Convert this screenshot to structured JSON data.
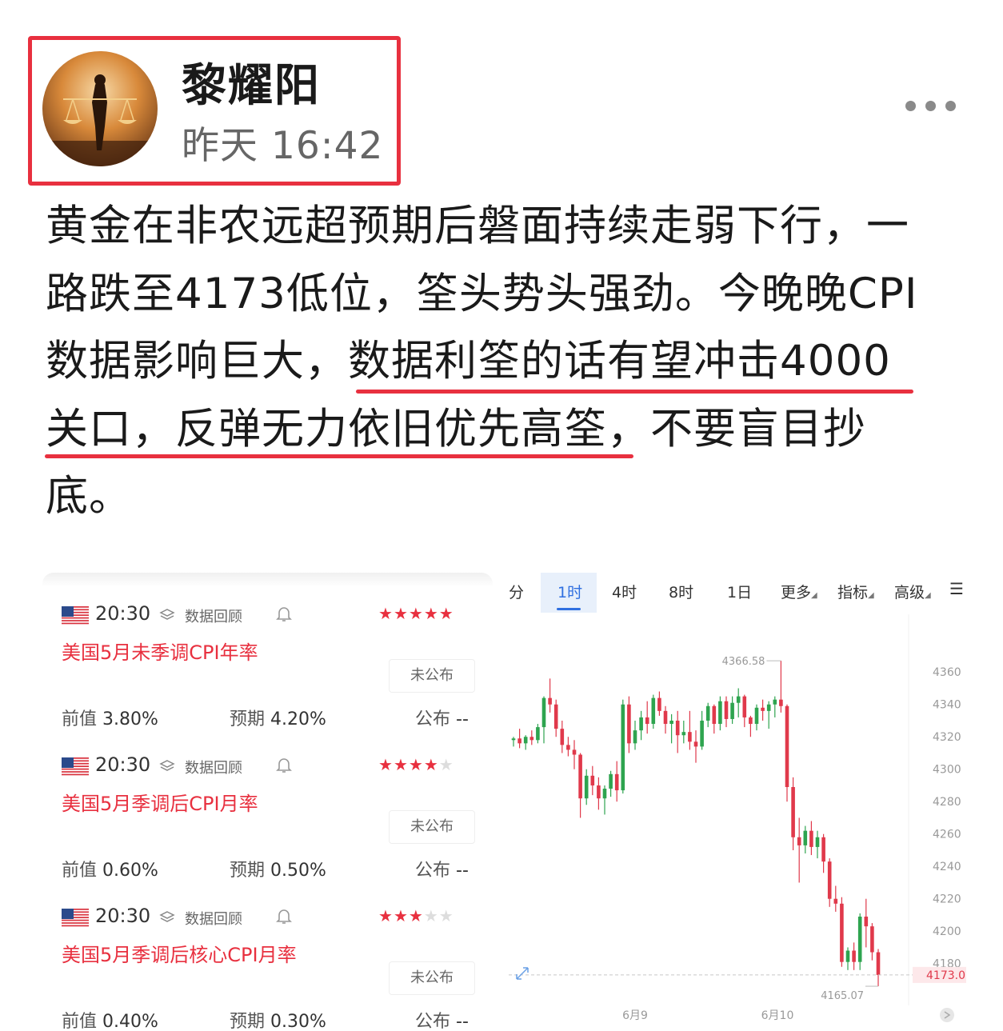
{
  "author": {
    "name": "黎耀阳",
    "time": "昨天 16:42"
  },
  "post": {
    "lines": [
      "黄金在非农远超预期后磐面持续走弱下行，一",
      "路跌至4173低位，筌头势头强劲。今晚晚CPI",
      "数据影响巨大，数据利筌的话有望冲击4000",
      "关口，反弹无力依旧优先高筌，不要盲目抄",
      "底。"
    ]
  },
  "calendar": {
    "items": [
      {
        "time": "20:30",
        "review_label": "数据回顾",
        "stars": 5,
        "title": "美国5月未季调CPI年率",
        "status": "未公布",
        "prev_label": "前值",
        "prev": "3.80%",
        "exp_label": "预期",
        "exp": "4.20%",
        "pub_label": "公布",
        "pub": "--"
      },
      {
        "time": "20:30",
        "review_label": "数据回顾",
        "stars": 4,
        "title": "美国5月季调后CPI月率",
        "status": "未公布",
        "prev_label": "前值",
        "prev": "0.60%",
        "exp_label": "预期",
        "exp": "0.50%",
        "pub_label": "公布",
        "pub": "--"
      },
      {
        "time": "20:30",
        "review_label": "数据回顾",
        "stars": 3,
        "title": "美国5月季调后核心CPI月率",
        "status": "未公布",
        "prev_label": "前值",
        "prev": "0.40%",
        "exp_label": "预期",
        "exp": "0.30%",
        "pub_label": "公布",
        "pub": "--"
      }
    ]
  },
  "chart_tabs": {
    "items": [
      "分",
      "1时",
      "4时",
      "8时",
      "1日",
      "更多",
      "指标",
      "高级"
    ],
    "active": "1时"
  },
  "chart_data": {
    "type": "candlestick",
    "yticks": [
      4360,
      4340,
      4320,
      4300,
      4280,
      4260,
      4240,
      4220,
      4200,
      4180
    ],
    "ylim": [
      4168,
      4370
    ],
    "xlabels": [
      "6月9",
      "6月10"
    ],
    "high_label": "4366.58",
    "low_label": "4165.07",
    "last_price": "4173.0",
    "colors": {
      "up": "#2ea44f",
      "down": "#e0394b",
      "last": "#e0394b"
    },
    "candles": [
      [
        4318,
        4320,
        4314,
        4319
      ],
      [
        4319,
        4325,
        4313,
        4316
      ],
      [
        4316,
        4321,
        4312,
        4320
      ],
      [
        4320,
        4324,
        4315,
        4318
      ],
      [
        4318,
        4328,
        4316,
        4326
      ],
      [
        4326,
        4345,
        4316,
        4344
      ],
      [
        4344,
        4356,
        4335,
        4340
      ],
      [
        4340,
        4343,
        4320,
        4325
      ],
      [
        4325,
        4330,
        4310,
        4315
      ],
      [
        4315,
        4320,
        4308,
        4312
      ],
      [
        4312,
        4318,
        4300,
        4309
      ],
      [
        4309,
        4310,
        4270,
        4282
      ],
      [
        4282,
        4300,
        4278,
        4296
      ],
      [
        4296,
        4302,
        4284,
        4290
      ],
      [
        4290,
        4295,
        4275,
        4282
      ],
      [
        4282,
        4290,
        4272,
        4288
      ],
      [
        4288,
        4299,
        4283,
        4297
      ],
      [
        4297,
        4305,
        4280,
        4287
      ],
      [
        4287,
        4343,
        4285,
        4340
      ],
      [
        4340,
        4345,
        4310,
        4316
      ],
      [
        4316,
        4330,
        4312,
        4324
      ],
      [
        4324,
        4336,
        4318,
        4332
      ],
      [
        4332,
        4342,
        4322,
        4328
      ],
      [
        4328,
        4346,
        4325,
        4344
      ],
      [
        4344,
        4348,
        4333,
        4336
      ],
      [
        4336,
        4339,
        4322,
        4328
      ],
      [
        4328,
        4334,
        4316,
        4330
      ],
      [
        4330,
        4336,
        4310,
        4321
      ],
      [
        4321,
        4330,
        4316,
        4323
      ],
      [
        4323,
        4336,
        4312,
        4317
      ],
      [
        4317,
        4324,
        4304,
        4314
      ],
      [
        4314,
        4336,
        4312,
        4330
      ],
      [
        4330,
        4341,
        4326,
        4339
      ],
      [
        4339,
        4340,
        4322,
        4328
      ],
      [
        4328,
        4345,
        4324,
        4342
      ],
      [
        4342,
        4345,
        4326,
        4331
      ],
      [
        4331,
        4345,
        4328,
        4341
      ],
      [
        4341,
        4350,
        4332,
        4345
      ],
      [
        4345,
        4346,
        4326,
        4332
      ],
      [
        4332,
        4333,
        4320,
        4328
      ],
      [
        4328,
        4340,
        4324,
        4338
      ],
      [
        4338,
        4343,
        4330,
        4336
      ],
      [
        4336,
        4342,
        4325,
        4340
      ],
      [
        4340,
        4345,
        4332,
        4343
      ],
      [
        4343,
        4367,
        4335,
        4339
      ],
      [
        4339,
        4340,
        4280,
        4289
      ],
      [
        4289,
        4295,
        4250,
        4258
      ],
      [
        4258,
        4270,
        4230,
        4253
      ],
      [
        4253,
        4265,
        4248,
        4262
      ],
      [
        4262,
        4268,
        4247,
        4252
      ],
      [
        4252,
        4262,
        4245,
        4258
      ],
      [
        4258,
        4260,
        4236,
        4243
      ],
      [
        4243,
        4245,
        4215,
        4220
      ],
      [
        4220,
        4228,
        4212,
        4217
      ],
      [
        4217,
        4221,
        4178,
        4181
      ],
      [
        4181,
        4190,
        4176,
        4188
      ],
      [
        4188,
        4193,
        4176,
        4181
      ],
      [
        4181,
        4211,
        4176,
        4209
      ],
      [
        4209,
        4220,
        4190,
        4203
      ],
      [
        4203,
        4205,
        4182,
        4187
      ],
      [
        4187,
        4189,
        4166,
        4173
      ]
    ]
  }
}
